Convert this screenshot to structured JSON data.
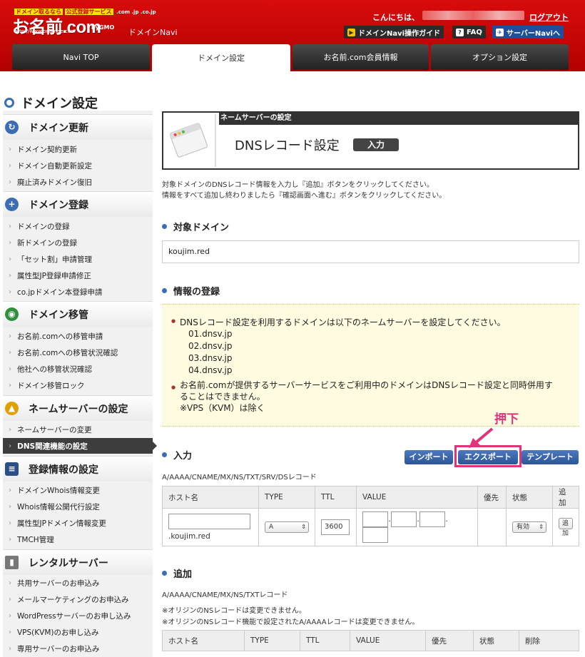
{
  "header": {
    "logo_tag_a": "ドメイン取るなら",
    "logo_tag_b": "公式登録サービス",
    "logo_domains": ".com .jp .co.jp",
    "logo_main": "お名前.com",
    "logo_url": "http://www.onamae.com",
    "logo_gmo": "byGMO",
    "app_name": "ドメインNavi",
    "greeting": "こんにちは、",
    "logout": "ログアウト",
    "buttons": {
      "guide": "ドメインNavi操作ガイド",
      "faq": "FAQ",
      "server": "サーバーNaviへ"
    }
  },
  "tabs": [
    "Navi TOP",
    "ドメイン設定",
    "お名前.com会員情報",
    "オプション設定"
  ],
  "page_title": "ドメイン設定",
  "sidebar": {
    "sections": [
      {
        "title": "ドメイン更新",
        "items": [
          "ドメイン契約更新",
          "ドメイン自動更新設定",
          "廃止済みドメイン復旧"
        ]
      },
      {
        "title": "ドメイン登録",
        "items": [
          "ドメインの登録",
          "新ドメインの登録",
          "「セット割」申請管理",
          "属性型JP登録申請修正",
          "co.jpドメイン本登録申請"
        ]
      },
      {
        "title": "ドメイン移管",
        "items": [
          "お名前.comへの移管申請",
          "お名前.comへの移管状況確認",
          "他社への移管状況確認",
          "ドメイン移管ロック"
        ]
      },
      {
        "title": "ネームサーバーの設定",
        "items": [
          "ネームサーバーの変更",
          "DNS関連機能の設定"
        ]
      },
      {
        "title": "登録情報の設定",
        "items": [
          "ドメインWhois情報変更",
          "Whois情報公開代行設定",
          "属性型JPドメイン情報変更",
          "TMCH管理"
        ]
      },
      {
        "title": "レンタルサーバー",
        "items": [
          "共用サーバーのお申込み",
          "メールマーケティングのお申込み",
          "WordPressサーバーのお申し込み",
          "VPS(KVM)のお申し込み",
          "専用サーバーのお申込み"
        ]
      }
    ]
  },
  "panel": {
    "bar": "ネームサーバーの設定",
    "title": "DNSレコード設定",
    "badge": "入力"
  },
  "description": [
    "対象ドメインのDNSレコード情報を入力し『追加』ボタンをクリックしてください。",
    "情報をすべて追加し終わりましたら『確認画面へ進む』ボタンをクリックしてください。"
  ],
  "target_domain": {
    "heading": "対象ドメイン",
    "value": "koujim.red"
  },
  "registration": {
    "heading": "情報の登録",
    "notice1": "DNSレコード設定を利用するドメインは以下のネームサーバーを設定してください。",
    "nameservers": [
      "01.dnsv.jp",
      "02.dnsv.jp",
      "03.dnsv.jp",
      "04.dnsv.jp"
    ],
    "notice2a": "お名前.comが提供するサーバーサービスをご利用中のドメインはDNSレコード設定と同時併用す",
    "notice2b": "ることはできません。",
    "notice2c": "※VPS（KVM）は除く"
  },
  "input_section": {
    "heading": "入力",
    "record_types": "A/AAAA/CNAME/MX/NS/TXT/SRV/DSレコード",
    "buttons": {
      "import": "インポート",
      "export": "エクスポート",
      "template": "テンプレート"
    },
    "annotation": "押下",
    "columns": [
      "ホスト名",
      "TYPE",
      "TTL",
      "VALUE",
      "優先",
      "状態",
      "追加"
    ],
    "host_suffix": ".koujim.red",
    "type_value": "A",
    "ttl_value": "3600",
    "status_value": "有効",
    "add_button": "追加"
  },
  "add_section": {
    "heading": "追加",
    "record_types": "A/AAAA/CNAME/MX/NS/TXTレコード",
    "note1": "※オリジンのNSレコードは変更できません。",
    "note2": "※オリジンのNSレコード機能で設定されたA/AAAAレコードは変更できません。",
    "columns": [
      "ホスト名",
      "TYPE",
      "TTL",
      "VALUE",
      "優先",
      "状態",
      "削除"
    ]
  }
}
